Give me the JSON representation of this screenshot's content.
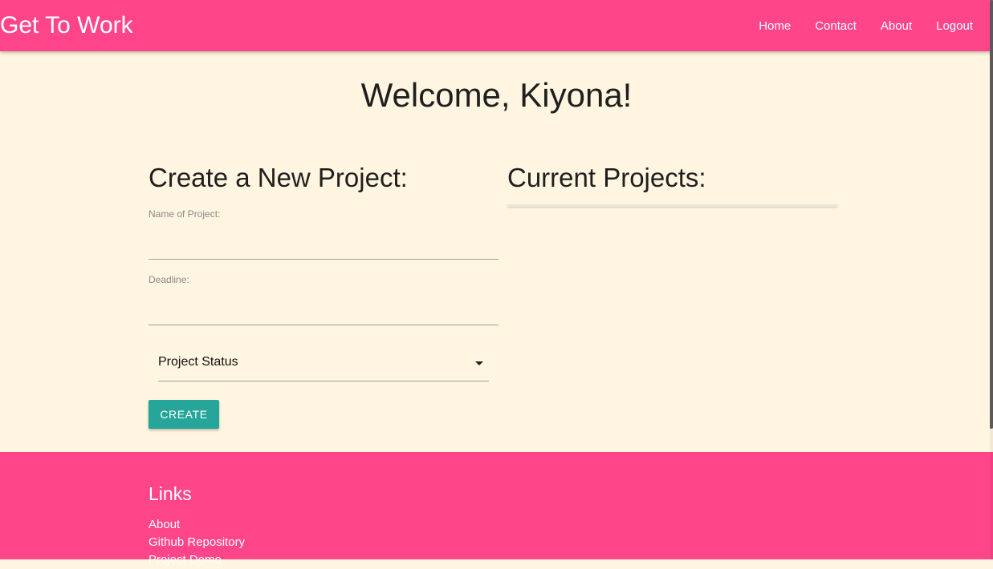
{
  "navbar": {
    "brand": "Get To Work",
    "links": [
      "Home",
      "Contact",
      "About",
      "Logout"
    ]
  },
  "main": {
    "welcome": "Welcome, Kiyona!",
    "create_form": {
      "heading": "Create a New Project:",
      "name_label": "Name of Project:",
      "name_value": "",
      "deadline_label": "Deadline:",
      "deadline_value": "",
      "status_selected": "Project Status",
      "submit_label": "CREATE"
    },
    "projects": {
      "heading": "Current Projects:"
    }
  },
  "footer": {
    "heading": "Links",
    "links": [
      "About",
      "Github Repository",
      "Project Demo"
    ]
  },
  "colors": {
    "brand_pink": "#ff4589",
    "page_background": "#fff5e0",
    "button_teal": "#26a69a"
  },
  "icons": {
    "dropdown": "caret-down-icon"
  }
}
